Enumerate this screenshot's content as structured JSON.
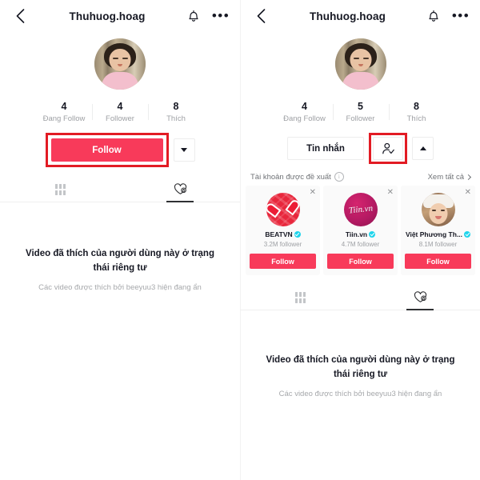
{
  "left": {
    "header": {
      "back_icon": "chevron-left-icon",
      "title": "Thuhuog.hoag",
      "bell_icon": "bell-icon",
      "more_icon": "more-dots-icon"
    },
    "avatar_alt": "profile-avatar",
    "stats": [
      {
        "value": "4",
        "label": "Đang Follow"
      },
      {
        "value": "4",
        "label": "Follower"
      },
      {
        "value": "8",
        "label": "Thích"
      }
    ],
    "actions": {
      "follow_label": "Follow",
      "dropdown_icon": "chevron-down-icon",
      "highlight_color": "#e21b24"
    },
    "tabs": [
      {
        "icon": "grid-icon",
        "active": false
      },
      {
        "icon": "heart-lock-icon",
        "active": true
      }
    ],
    "empty": {
      "title": "Video đã thích của người dùng này ở trạng thái riêng tư",
      "subtitle": "Các video được thích bởi beeyuu3 hiện đang ẩn"
    }
  },
  "right": {
    "header": {
      "back_icon": "chevron-left-icon",
      "title": "Thuhuog.hoag",
      "bell_icon": "bell-icon",
      "more_icon": "more-dots-icon"
    },
    "avatar_alt": "profile-avatar",
    "stats": [
      {
        "value": "4",
        "label": "Đang Follow"
      },
      {
        "value": "5",
        "label": "Follower"
      },
      {
        "value": "8",
        "label": "Thích"
      }
    ],
    "actions": {
      "message_label": "Tin nhắn",
      "person_check_icon": "person-check-icon",
      "dropdown_icon": "chevron-up-icon",
      "highlight_color": "#e21b24"
    },
    "suggested": {
      "title": "Tài khoản được đề xuất",
      "info_icon": "info-icon",
      "see_all": "Xem tất cả",
      "see_all_icon": "chevron-right-icon",
      "cards": [
        {
          "close_icon": "close-icon",
          "avatar": "beatvn-logo",
          "name": "BEATVN",
          "verified": true,
          "followers": "3.2M follower",
          "follow_label": "Follow"
        },
        {
          "close_icon": "close-icon",
          "avatar": "tiin-logo",
          "name": "Tiin.vn",
          "verified": true,
          "followers": "4.7M follower",
          "follow_label": "Follow"
        },
        {
          "close_icon": "close-icon",
          "avatar": "viet-phuong-thoa-photo",
          "name": "Việt Phương Th...",
          "verified": true,
          "followers": "8.1M follower",
          "follow_label": "Follow"
        }
      ]
    },
    "tabs": [
      {
        "icon": "grid-icon",
        "active": false
      },
      {
        "icon": "heart-lock-icon",
        "active": true
      }
    ],
    "empty": {
      "title": "Video đã thích của người dùng này ở trạng thái riêng tư",
      "subtitle": "Các video được thích bởi beeyuu3 hiện đang ẩn"
    }
  },
  "theme": {
    "accent": "#f83a5a",
    "verified": "#20d5ec",
    "highlight": "#e21b24",
    "text": "#161823",
    "muted": "#9ea0a4"
  }
}
